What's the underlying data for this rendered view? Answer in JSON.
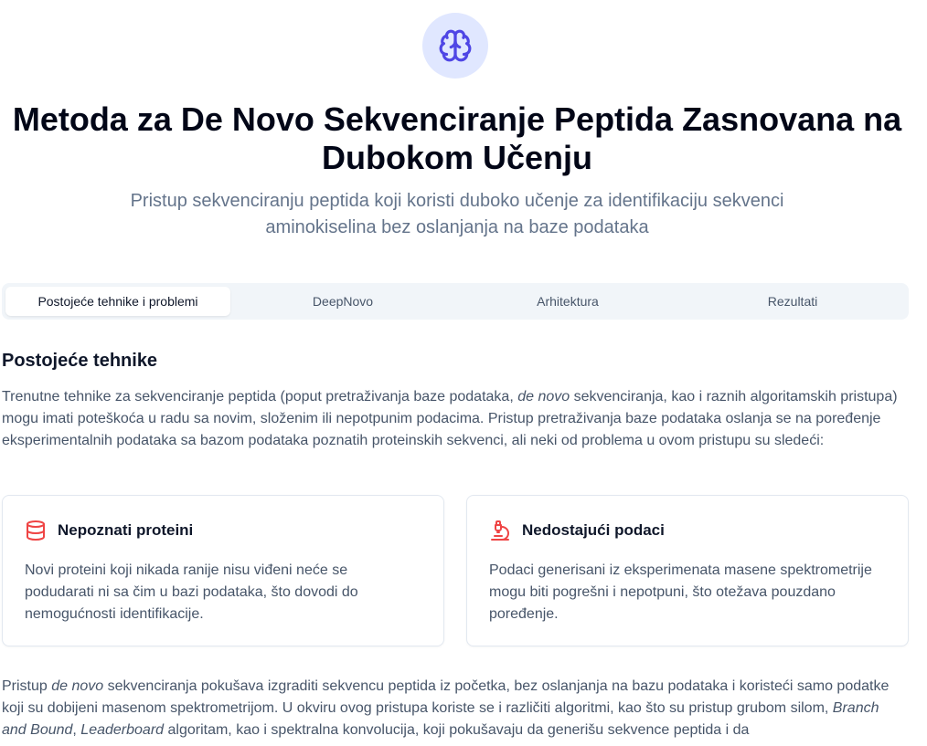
{
  "header": {
    "logo_icon": "brain-icon",
    "title": "Metoda za De Novo Sekvenciranje Peptida Zasnovana na Dubokom Učenju",
    "subtitle": "Pristup sekvenciranju peptida koji koristi duboko učenje za identifikaciju sekvenci aminokiselina bez oslanjanja na baze podataka"
  },
  "tabs": [
    {
      "label": "Postojeće tehnike i problemi",
      "active": true
    },
    {
      "label": "DeepNovo",
      "active": false
    },
    {
      "label": "Arhitektura",
      "active": false
    },
    {
      "label": "Rezultati",
      "active": false
    }
  ],
  "section": {
    "heading": "Postojeće tehnike",
    "intro": {
      "before": "Trenutne tehnike za sekvenciranje peptida (poput pretraživanja baze podataka, ",
      "em": "de novo",
      "after": " sekvenciranja, kao i raznih algoritamskih pristupa) mogu imati poteškoća u radu sa novim, složenim ili nepotpunim podacima. Pristup pretraživanja baze podataka oslanja se na poređenje eksperimentalnih podataka sa bazom podataka poznatih proteinskih sekvenci, ali neki od problema u ovom pristupu su sledeći:"
    },
    "cards": [
      {
        "icon": "database-icon",
        "title": "Nepoznati proteini",
        "text": "Novi proteini koji nikada ranije nisu viđeni neće se podudarati ni sa čim u bazi podataka, što dovodi do nemogućnosti identifikacije."
      },
      {
        "icon": "microscope-icon",
        "title": "Nedostajući podaci",
        "text": "Podaci generisani iz eksperimenata masene spektrometrije mogu biti pogrešni i nepotpuni, što otežava pouzdano poređenje."
      }
    ],
    "outro": {
      "p1": "Pristup ",
      "em1": "de novo",
      "p2": " sekvenciranja pokušava izgraditi sekvencu peptida iz početka, bez oslanjanja na bazu podataka i koristeći samo podatke koji su dobijeni masenom spektrometrijom. U okviru ovog pristupa koriste se i različiti algoritmi, kao što su pristup grubom silom, ",
      "em2": "Branch and Bound",
      "p3": ", ",
      "em3": "Leaderboard",
      "p4": " algoritam, kao i spektralna konvolucija, koji pokušavaju da generišu sekvence peptida i da"
    }
  },
  "colors": {
    "accent": "#4f46e5",
    "accent_bg": "#e0e7ff",
    "card_icon": "#ef4444",
    "muted_text": "#475569",
    "subtitle_text": "#64748b"
  }
}
